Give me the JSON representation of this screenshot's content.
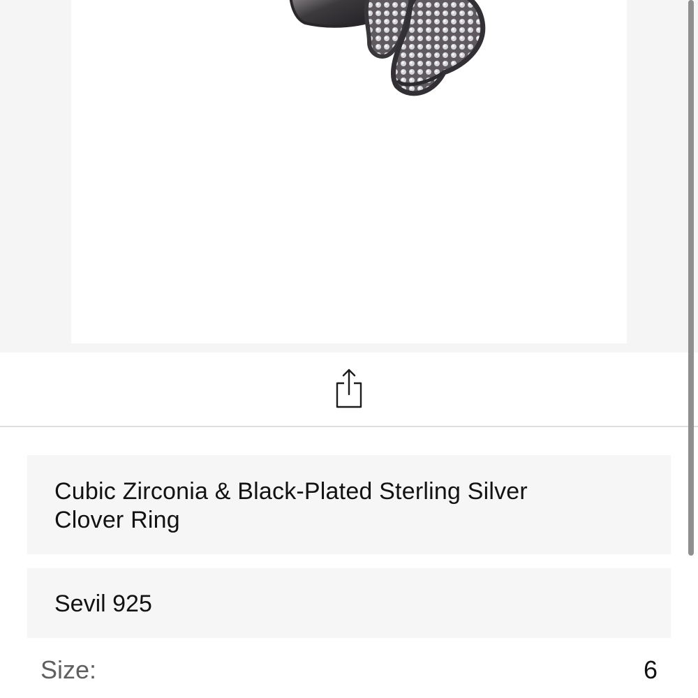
{
  "product": {
    "title": "Cubic Zirconia & Black-Plated Sterling Silver Clover Ring",
    "brand": "Sevil 925",
    "size_label": "Size:",
    "size_value": "6"
  },
  "icons": {
    "share": "share-icon"
  },
  "colors": {
    "page_background": "#ffffff",
    "gallery_background": "#f5f5f5",
    "card_background": "#f6f6f6",
    "divider": "#dedede",
    "text_primary": "#121212",
    "text_secondary": "#5f5f5f"
  }
}
